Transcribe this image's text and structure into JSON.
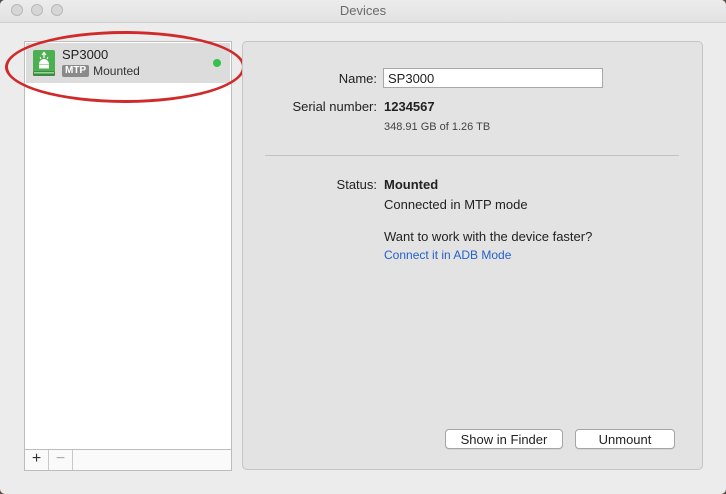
{
  "window": {
    "title": "Devices"
  },
  "sidebar": {
    "devices": [
      {
        "name": "SP3000",
        "badge": "MTP",
        "status": "Mounted",
        "icon": "android-device-icon",
        "connected_color": "#33c24a"
      }
    ],
    "footer": {
      "add_label": "+",
      "remove_label": "−"
    }
  },
  "details": {
    "name_label": "Name:",
    "name_value": "SP3000",
    "serial_label": "Serial number:",
    "serial_value": "1234567",
    "storage_text": "348.91 GB of 1.26 TB",
    "status_label": "Status:",
    "status_value": "Mounted",
    "status_detail": "Connected in MTP mode",
    "faster_prompt": "Want to work with the device faster?",
    "adb_link": "Connect it in ADB Mode"
  },
  "actions": {
    "show_in_finder": "Show in Finder",
    "unmount": "Unmount"
  },
  "colors": {
    "link": "#2460c8",
    "annotation": "#d02a2a"
  }
}
